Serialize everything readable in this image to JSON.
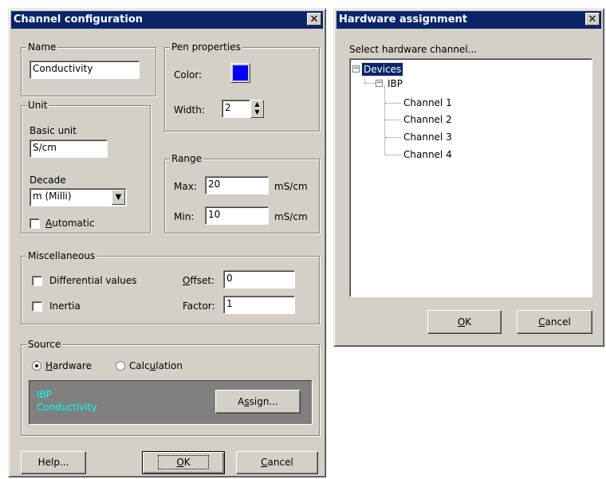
{
  "channel_dialog": {
    "title": "Channel configuration",
    "close_glyph": "✕",
    "name_group": {
      "legend": "Name",
      "value": "Conductivity"
    },
    "pen_group": {
      "legend": "Pen properties",
      "color_label": "Color:",
      "color_value": "#0000ff",
      "width_label": "Width:",
      "width_value": "2"
    },
    "unit_group": {
      "legend": "Unit",
      "basic_unit_label": "Basic unit",
      "basic_unit_value": "S/cm",
      "decade_label": "Decade",
      "decade_value": "m (Milli)",
      "automatic_prefix": "A",
      "automatic_rest": "utomatic",
      "automatic_checked": false
    },
    "range_group": {
      "legend": "Range",
      "max_label": "Max:",
      "max_value": "20",
      "max_unit": "mS/cm",
      "min_label": "Min:",
      "min_value": "10",
      "min_unit": "mS/cm"
    },
    "misc_group": {
      "legend": "Miscellaneous",
      "differential_label": "Differential values",
      "differential_checked": false,
      "inertia_label": "Inertia",
      "inertia_checked": false,
      "offset_prefix": "O",
      "offset_rest": "ffset:",
      "offset_value": "0",
      "factor_label": "Factor:",
      "factor_value": "1"
    },
    "source_group": {
      "legend": "Source",
      "hardware_prefix": "H",
      "hardware_rest": "ardware",
      "hardware_selected": true,
      "calc_a": "Calc",
      "calc_u": "u",
      "calc_b": "lation",
      "info_line1": "IBP",
      "info_line2": "Conductivity",
      "assign_a": "A",
      "assign_u": "s",
      "assign_b": "sign..."
    },
    "buttons": {
      "help": "Help...",
      "ok_u": "O",
      "ok_rest": "K",
      "cancel_u": "C",
      "cancel_rest": "ancel"
    }
  },
  "hardware_dialog": {
    "title": "Hardware assignment",
    "close_glyph": "✕",
    "prompt": "Select hardware channel...",
    "tree": {
      "root": "Devices",
      "device": "IBP",
      "channels": [
        "Channel 1",
        "Channel 2",
        "Channel 3",
        "Channel 4"
      ]
    },
    "buttons": {
      "ok_u": "O",
      "ok_rest": "K",
      "cancel_u": "C",
      "cancel_rest": "ancel"
    }
  },
  "colors": {
    "titlebar": "#0a246a",
    "face": "#d4d0c8",
    "info_panel": "#808080",
    "info_text": "#00ffff",
    "selection": "#0a246a"
  }
}
